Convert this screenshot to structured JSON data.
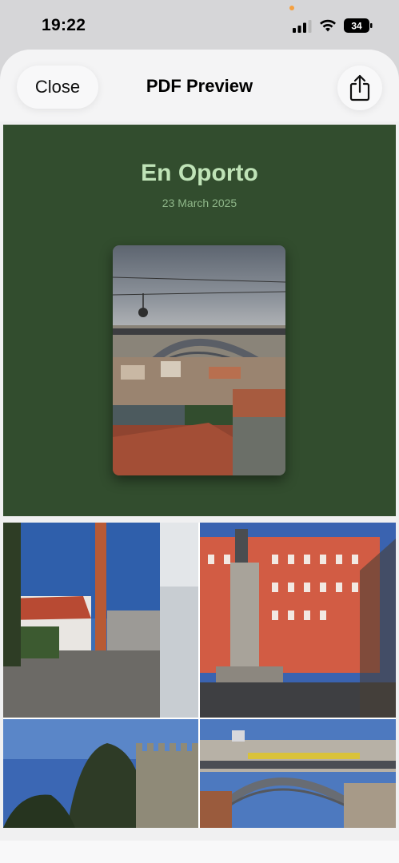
{
  "status_bar": {
    "time": "19:22",
    "battery": "34"
  },
  "nav": {
    "close_label": "Close",
    "title": "PDF Preview",
    "share_icon": "share-icon"
  },
  "document": {
    "title": "En Oporto",
    "date": "23 March 2025",
    "colors": {
      "cover_background": "#324d2e",
      "title_color": "#bfe3b7",
      "date_color": "#8fb789"
    }
  }
}
